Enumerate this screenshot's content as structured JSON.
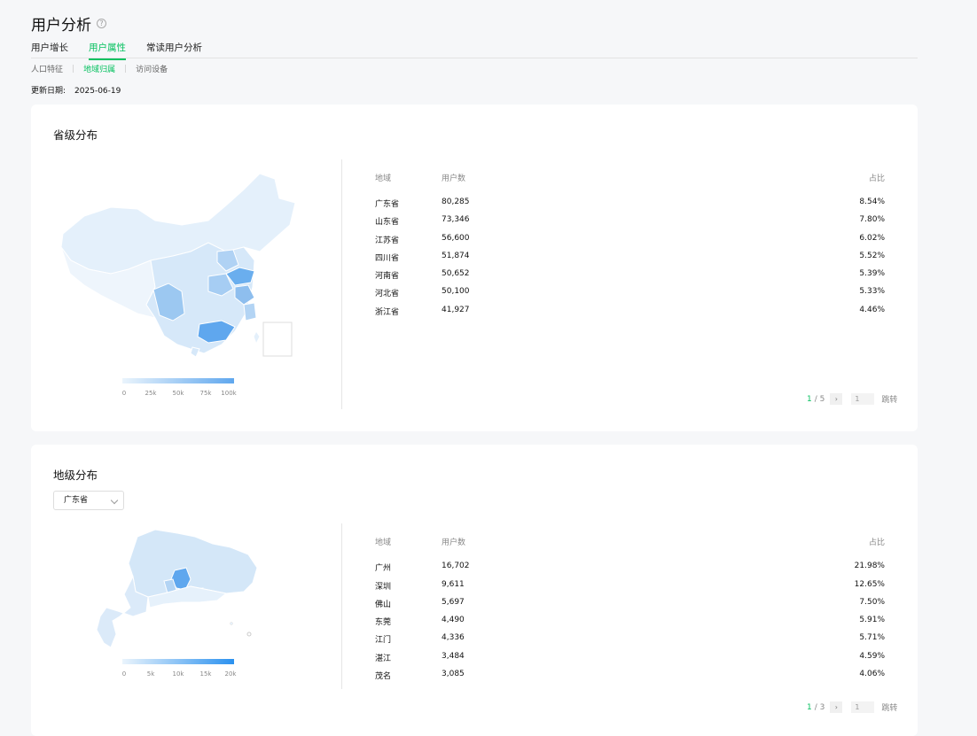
{
  "header": {
    "title": "用户分析",
    "help_icon": "question-circle-icon"
  },
  "tabs": [
    {
      "label": "用户增长",
      "active": false
    },
    {
      "label": "用户属性",
      "active": true
    },
    {
      "label": "常读用户分析",
      "active": false
    }
  ],
  "subtabs": [
    {
      "label": "人口特征",
      "active": false
    },
    {
      "label": "地域归属",
      "active": true
    },
    {
      "label": "访问设备",
      "active": false
    }
  ],
  "update": {
    "label": "更新日期:",
    "date": "2025-06-19"
  },
  "province_card": {
    "title": "省级分布",
    "legend": [
      "0",
      "25k",
      "50k",
      "75k",
      "100k"
    ],
    "columns": {
      "region": "地域",
      "users": "用户数",
      "share": "占比"
    },
    "rows": [
      {
        "region": "广东省",
        "users": "80,285",
        "share": "8.54%"
      },
      {
        "region": "山东省",
        "users": "73,346",
        "share": "7.80%"
      },
      {
        "region": "江苏省",
        "users": "56,600",
        "share": "6.02%"
      },
      {
        "region": "四川省",
        "users": "51,874",
        "share": "5.52%"
      },
      {
        "region": "河南省",
        "users": "50,652",
        "share": "5.39%"
      },
      {
        "region": "河北省",
        "users": "50,100",
        "share": "5.33%"
      },
      {
        "region": "浙江省",
        "users": "41,927",
        "share": "4.46%"
      }
    ],
    "pager": {
      "current": "1",
      "total": "/ 5",
      "next": "›",
      "input": "1",
      "jump": "跳转"
    }
  },
  "city_card": {
    "title": "地级分布",
    "select_value": "广东省",
    "legend": [
      "0",
      "5k",
      "10k",
      "15k",
      "20k"
    ],
    "columns": {
      "region": "地域",
      "users": "用户数",
      "share": "占比"
    },
    "rows": [
      {
        "region": "广州",
        "users": "16,702",
        "share": "21.98%"
      },
      {
        "region": "深圳",
        "users": "9,611",
        "share": "12.65%"
      },
      {
        "region": "佛山",
        "users": "5,697",
        "share": "7.50%"
      },
      {
        "region": "东莞",
        "users": "4,490",
        "share": "5.91%"
      },
      {
        "region": "江门",
        "users": "4,336",
        "share": "5.71%"
      },
      {
        "region": "湛江",
        "users": "3,484",
        "share": "4.59%"
      },
      {
        "region": "茂名",
        "users": "3,085",
        "share": "4.06%"
      }
    ],
    "pager": {
      "current": "1",
      "total": "/ 3",
      "next": "›",
      "input": "1",
      "jump": "跳转"
    }
  },
  "colors": {
    "accent": "#07c160",
    "map_light": "#eaf4fc",
    "map_dark": "#5fa7ee"
  }
}
